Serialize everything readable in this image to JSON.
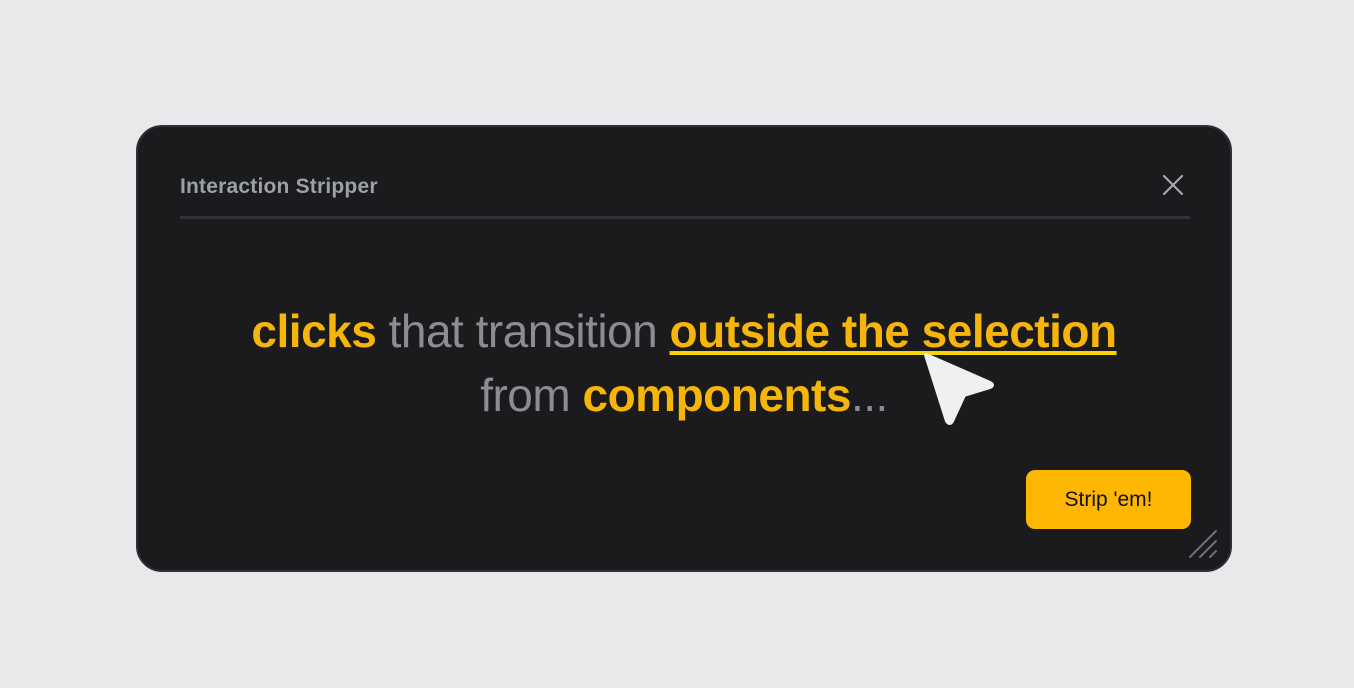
{
  "dialog": {
    "title": "Interaction Stripper",
    "close_icon": "close-icon",
    "resize_icon": "resize-handle-icon",
    "cursor_icon": "mouse-pointer-icon"
  },
  "headline": {
    "line1": [
      {
        "text": "clicks",
        "style": "strong"
      },
      {
        "text": " that transition ",
        "style": "light"
      },
      {
        "text": "outside the selection",
        "style": "strong-underlined"
      }
    ],
    "line2": [
      {
        "text": "from ",
        "style": "light"
      },
      {
        "text": "components",
        "style": "strong"
      },
      {
        "text": "...",
        "style": "light"
      }
    ]
  },
  "actions": {
    "strip_label": "Strip 'em!"
  },
  "colors": {
    "accent": "#fdb702",
    "underline": "#f5d20a",
    "panel_bg": "#1b1b1d",
    "page_bg": "#e8e9eb",
    "muted_text": "#8c8d90",
    "title_text": "#9aa1a8"
  }
}
